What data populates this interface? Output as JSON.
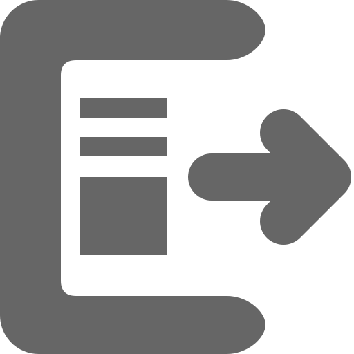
{
  "icon": {
    "name": "export-icon",
    "color": "#666666",
    "background": "#ffffff"
  }
}
